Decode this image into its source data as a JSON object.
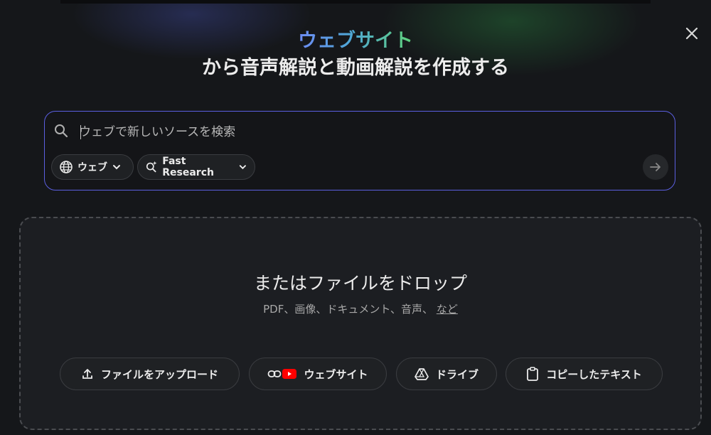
{
  "header": {
    "title_accent": "ウェブサイト",
    "title_main": "から音声解説と動画解説を作成する"
  },
  "search": {
    "placeholder": "ウェブで新しいソースを検索",
    "value": "",
    "chips": [
      {
        "label": "ウェブ",
        "icon": "globe-icon"
      },
      {
        "label": "Fast Research",
        "icon": "search-sparkle-icon"
      }
    ],
    "submit_icon": "arrow-right-icon"
  },
  "drop_zone": {
    "title": "またはファイルをドロップ",
    "subtitle": "PDF、画像、ドキュメント、音声、",
    "subtitle_link": "など",
    "actions": [
      {
        "label": "ファイルをアップロード",
        "icon": "upload-icon"
      },
      {
        "label": "ウェブサイト",
        "icon": "link-youtube-icon"
      },
      {
        "label": "ドライブ",
        "icon": "drive-icon"
      },
      {
        "label": "コピーしたテキスト",
        "icon": "clipboard-icon"
      }
    ]
  },
  "colors": {
    "accent_border": "#5b5fe0",
    "youtube_red": "#ff0000",
    "background": "#15171a"
  }
}
